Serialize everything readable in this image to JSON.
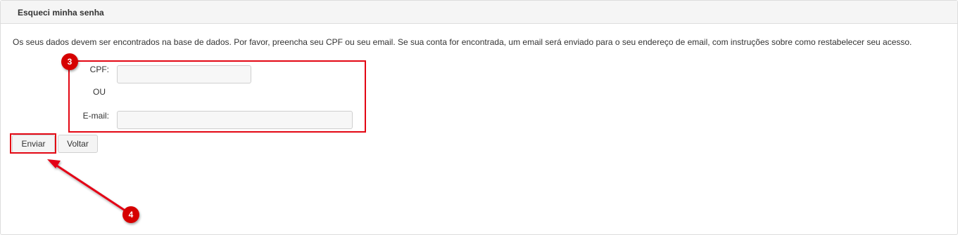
{
  "panel": {
    "title": "Esqueci minha senha"
  },
  "intro": "Os seus dados devem ser encontrados na base de dados. Por favor, preencha seu CPF ou seu email. Se sua conta for encontrada, um email será enviado para o seu endereço de email, com instruções sobre como restabelecer seu acesso.",
  "form": {
    "cpf_label": "CPF:",
    "cpf_value": "",
    "or_label": "OU",
    "email_label": "E-mail:",
    "email_value": ""
  },
  "buttons": {
    "submit": "Enviar",
    "back": "Voltar"
  },
  "annotations": {
    "marker_3": "3",
    "marker_4": "4",
    "highlight_color": "#e30613",
    "marker_color": "#d60000"
  }
}
